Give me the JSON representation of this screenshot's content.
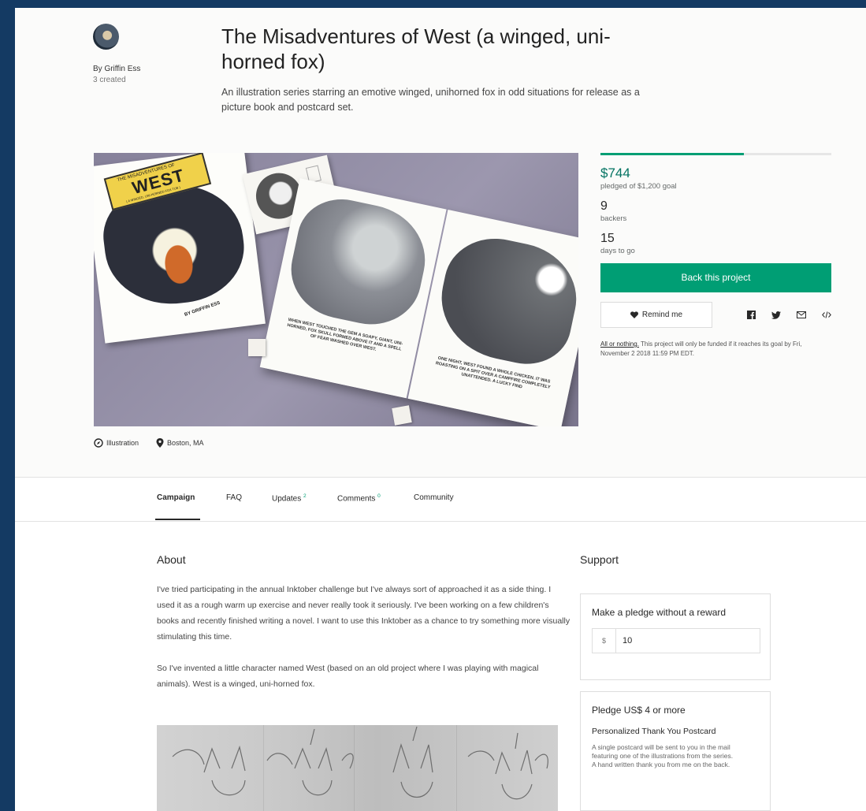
{
  "creator": {
    "by_line": "By Griffin Ess",
    "created_count": "3 created"
  },
  "project": {
    "title": "The Misadventures of West (a winged, uni-horned fox)",
    "blurb": "An illustration series starring an emotive winged, unihorned fox in odd situations for release as a picture book and postcard set.",
    "category": "Illustration",
    "location": "Boston, MA"
  },
  "media": {
    "cover_title_small": "THE MISADVENTURES OF",
    "cover_title_big": "WEST",
    "cover_subtitle": "( A WINGED, UNI-HORNED FOX TUB )",
    "cover_author": "BY GRIFFIN ESS",
    "page_left_caption": "WHEN WEST TOUCHED THE GEM A SOAPY, GIANT, UNI-HORNED, FOX SKULL FORMED ABOVE IT AND A SPELL OF FEAR WASHED OVER WEST.",
    "page_right_caption": "ONE NIGHT, WEST FOUND A WHOLE CHICKEN. IT WAS ROASTING ON A SPIT OVER A CAMPFIRE COMPLETELY UNATTENDED. A LUCKY FIND"
  },
  "stats": {
    "funded_fraction": 0.62,
    "pledged_amount": "$744",
    "pledged_label": "pledged of $1,200 goal",
    "backers_count": "9",
    "backers_label": "backers",
    "days_count": "15",
    "days_label": "days to go",
    "back_button": "Back this project",
    "remind_button": "Remind me",
    "share_icons": [
      "facebook-icon",
      "twitter-icon",
      "email-icon",
      "embed-icon"
    ],
    "fine_print_link": "All or nothing.",
    "fine_print": " This project will only be funded if it reaches its goal by Fri, November 2 2018 11:59 PM EDT."
  },
  "tabs": [
    {
      "label": "Campaign",
      "count": ""
    },
    {
      "label": "FAQ",
      "count": ""
    },
    {
      "label": "Updates",
      "count": "2"
    },
    {
      "label": "Comments",
      "count": "0"
    },
    {
      "label": "Community",
      "count": ""
    }
  ],
  "about": {
    "heading": "About",
    "paragraphs": [
      "I've tried participating in the annual Inktober challenge but I've always sort of approached it as a side thing. I used it as a rough warm up exercise and never really took it seriously. I've been working on a few children's books and recently finished writing a novel. I want to use this Inktober as a chance to try something more visually stimulating this time.",
      "So I've invented a little character named West (based on an old project where I was playing with magical animals). West is a winged, uni-horned fox."
    ]
  },
  "support": {
    "heading": "Support",
    "no_reward": {
      "title": "Make a pledge without a reward",
      "currency": "$",
      "amount": "10"
    },
    "reward": {
      "title": "Pledge US$ 4 or more",
      "name": "Personalized Thank You Postcard",
      "description_1": "A single postcard will be sent to you in the mail featuring one of the illustrations from the series.",
      "description_2": "A hand written thank you from me on the back."
    }
  },
  "colors": {
    "accent_green": "#009e74",
    "pledged_green": "#037362",
    "frame_blue": "#143a63"
  }
}
